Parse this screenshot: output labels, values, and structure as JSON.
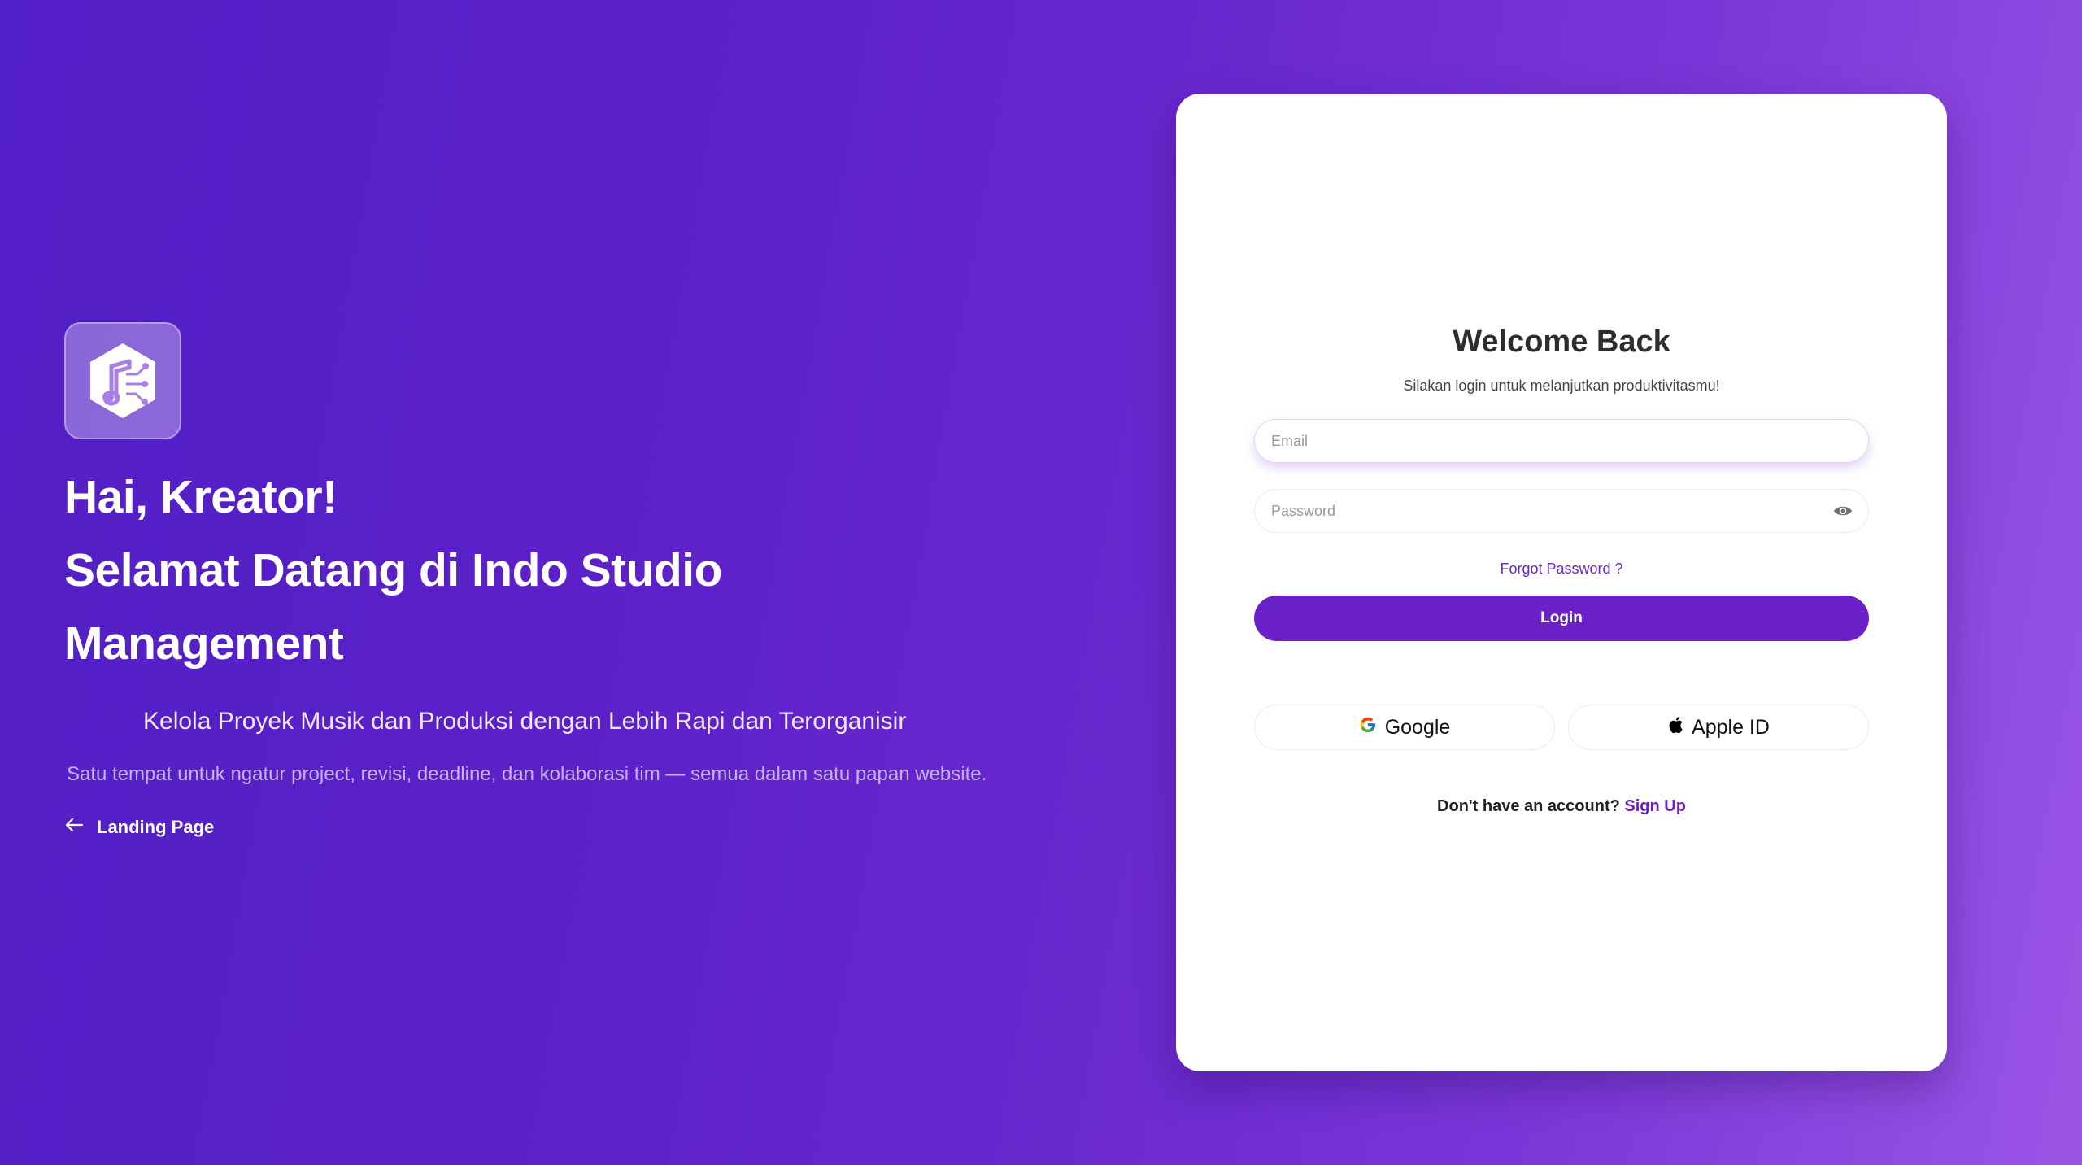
{
  "hero": {
    "logo_icon": "music-circuit-logo-icon",
    "greeting": "Hai, Kreator!",
    "title_line1": "Selamat Datang di Indo Studio",
    "title_line2": "Management",
    "tagline": "Kelola Proyek Musik dan Produksi dengan Lebih Rapi dan Terorganisir",
    "description": "Satu tempat untuk ngatur project, revisi, deadline, dan kolaborasi tim — semua dalam satu papan website.",
    "back_link": "Landing Page"
  },
  "login": {
    "title": "Welcome Back",
    "subtitle": "Silakan login untuk melanjutkan produktivitasmu!",
    "email_placeholder": "Email",
    "email_value": "",
    "password_placeholder": "Password",
    "password_value": "",
    "forgot": "Forgot Password ?",
    "submit": "Login",
    "google": "Google",
    "apple": "Apple ID",
    "no_account": "Don't have an account?",
    "signup": "Sign Up"
  },
  "colors": {
    "accent": "#6a22c8",
    "background_start": "#5120c6",
    "background_end": "#9a55e6"
  }
}
